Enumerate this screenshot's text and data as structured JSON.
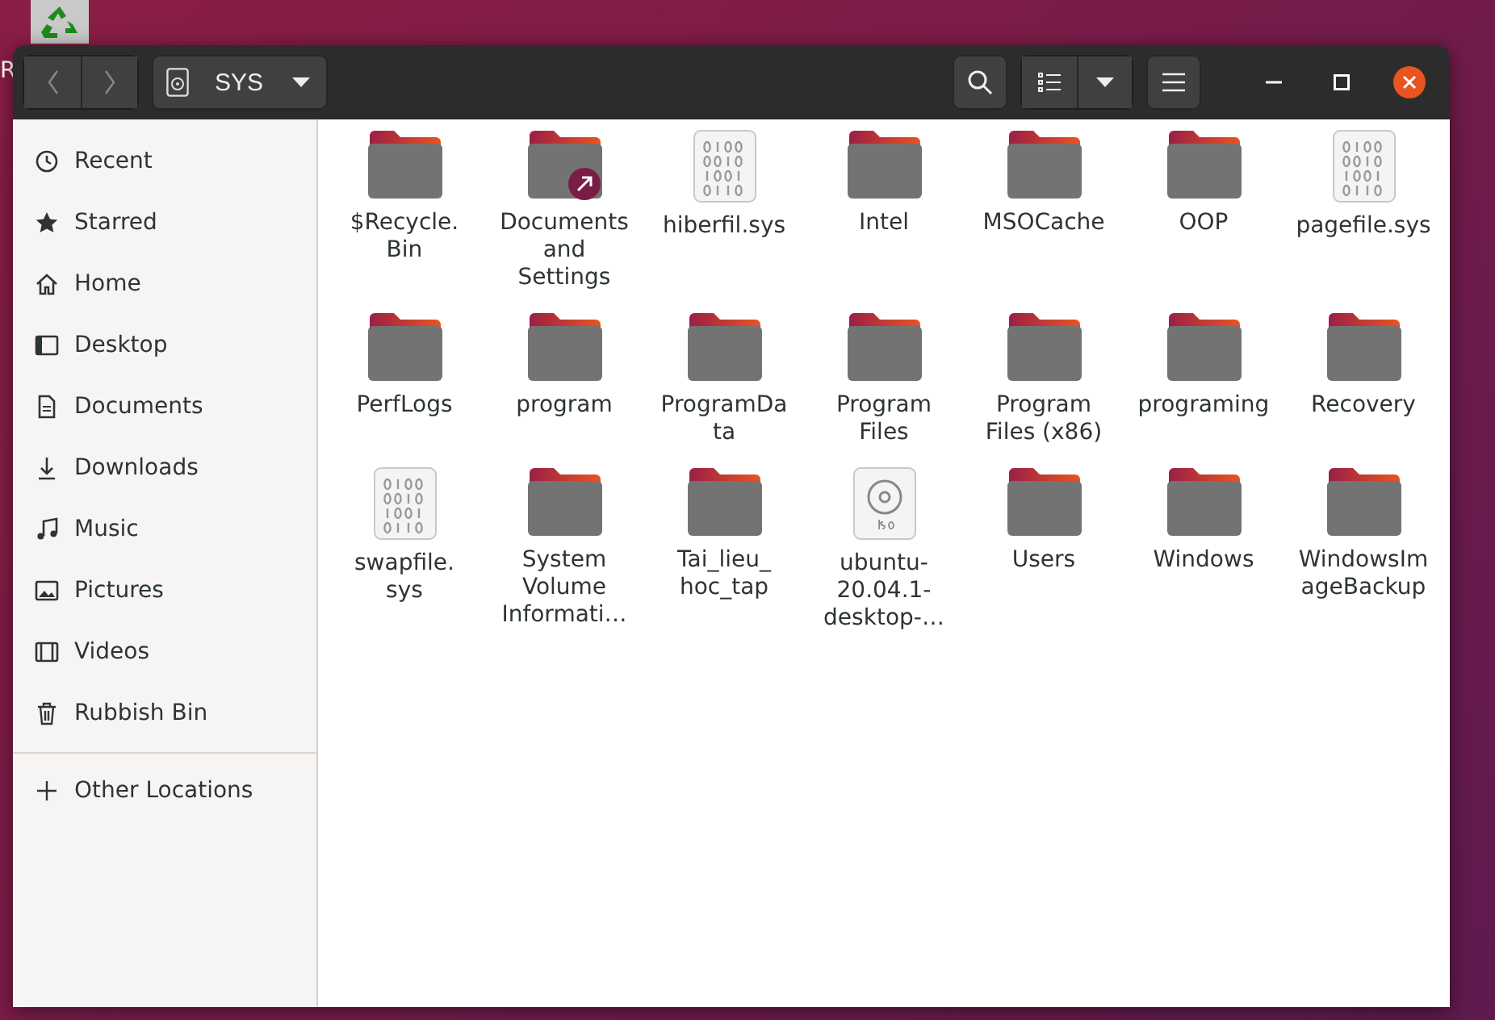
{
  "desktop": {
    "icon_label": "R"
  },
  "window": {
    "location": "SYS"
  },
  "sidebar": {
    "items": [
      {
        "label": "Recent",
        "kind": "clock",
        "selected": false
      },
      {
        "label": "Starred",
        "kind": "star",
        "selected": false
      },
      {
        "label": "Home",
        "kind": "home",
        "selected": false
      },
      {
        "label": "Desktop",
        "kind": "desktop",
        "selected": false
      },
      {
        "label": "Documents",
        "kind": "document",
        "selected": false
      },
      {
        "label": "Downloads",
        "kind": "download",
        "selected": false
      },
      {
        "label": "Music",
        "kind": "music",
        "selected": false
      },
      {
        "label": "Pictures",
        "kind": "picture",
        "selected": false
      },
      {
        "label": "Videos",
        "kind": "video",
        "selected": false
      },
      {
        "label": "Rubbish Bin",
        "kind": "trash",
        "selected": false
      }
    ],
    "other": {
      "label": "Other Locations"
    }
  },
  "files": [
    {
      "kind": "folder",
      "lines": [
        "$Recycle.",
        "Bin"
      ]
    },
    {
      "kind": "link-folder",
      "lines": [
        "Documents",
        "and",
        "Settings"
      ]
    },
    {
      "kind": "binary",
      "lines": [
        "hiberfil.sys"
      ]
    },
    {
      "kind": "folder",
      "lines": [
        "Intel"
      ]
    },
    {
      "kind": "folder",
      "lines": [
        "MSOCache"
      ]
    },
    {
      "kind": "folder",
      "lines": [
        "OOP"
      ]
    },
    {
      "kind": "binary",
      "lines": [
        "pagefile.sys"
      ]
    },
    {
      "kind": "folder",
      "lines": [
        "PerfLogs"
      ]
    },
    {
      "kind": "folder",
      "lines": [
        "program"
      ]
    },
    {
      "kind": "folder",
      "lines": [
        "ProgramDa",
        "ta"
      ]
    },
    {
      "kind": "folder",
      "lines": [
        "Program",
        "Files"
      ]
    },
    {
      "kind": "folder",
      "lines": [
        "Program",
        "Files (x86)"
      ]
    },
    {
      "kind": "folder",
      "lines": [
        "programing"
      ]
    },
    {
      "kind": "folder",
      "lines": [
        "Recovery"
      ]
    },
    {
      "kind": "binary",
      "lines": [
        "swapfile.",
        "sys"
      ]
    },
    {
      "kind": "folder",
      "lines": [
        "System",
        "Volume",
        "Informati…"
      ]
    },
    {
      "kind": "folder",
      "lines": [
        "Tai_lieu_",
        "hoc_tap"
      ]
    },
    {
      "kind": "iso",
      "lines": [
        "ubuntu-",
        "20.04.1-",
        "desktop-…"
      ]
    },
    {
      "kind": "folder",
      "lines": [
        "Users"
      ]
    },
    {
      "kind": "folder",
      "lines": [
        "Windows"
      ]
    },
    {
      "kind": "folder",
      "lines": [
        "WindowsIm",
        "ageBackup"
      ]
    }
  ]
}
